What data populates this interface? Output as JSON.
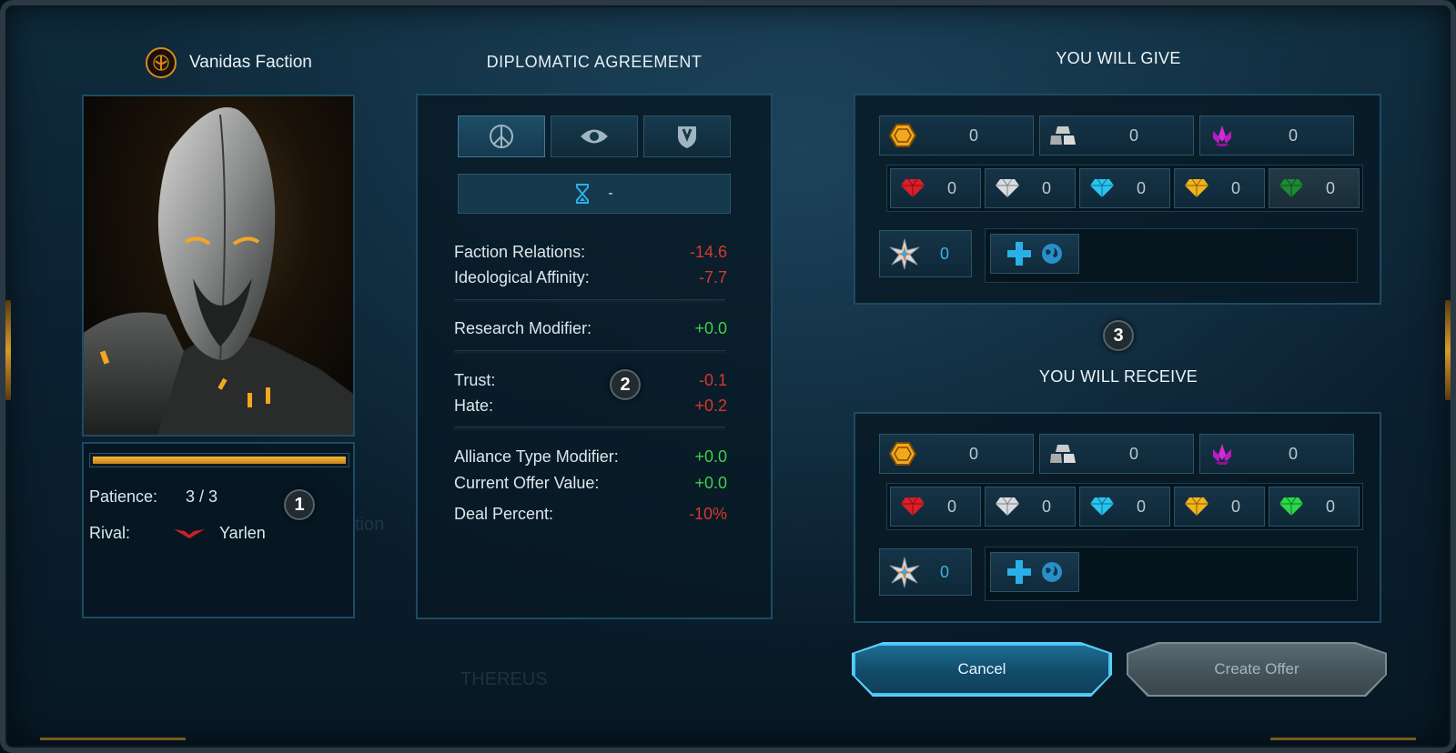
{
  "left": {
    "faction_name": "Vanidas Faction",
    "patience_label": "Patience:",
    "patience_value": "3 / 3",
    "patience_fill": 1.0,
    "rival_label": "Rival:",
    "rival_name": "Yarlen",
    "badge": "1"
  },
  "middle": {
    "title": "DIPLOMATIC AGREEMENT",
    "tabs": [
      {
        "icon": "peace-icon",
        "active": true
      },
      {
        "icon": "eye-icon",
        "active": false
      },
      {
        "icon": "shield-icon",
        "active": false
      }
    ],
    "duration_value": "-",
    "stats": {
      "faction_relations": {
        "label": "Faction Relations:",
        "value": "-14.6"
      },
      "ideological_affinity": {
        "label": "Ideological Affinity:",
        "value": "-7.7"
      },
      "research_modifier": {
        "label": "Research Modifier:",
        "value": "+0.0"
      },
      "trust": {
        "label": "Trust:",
        "value": "-0.1"
      },
      "hate": {
        "label": "Hate:",
        "value": "+0.2"
      },
      "alliance_type_modifier": {
        "label": "Alliance Type Modifier:",
        "value": "+0.0"
      },
      "current_offer_value": {
        "label": "Current Offer Value:",
        "value": "+0.0"
      },
      "deal_percent": {
        "label": "Deal Percent:",
        "value": "-10%"
      }
    },
    "badge": "2"
  },
  "give": {
    "title": "YOU WILL GIVE",
    "resources": {
      "credits": "0",
      "alloys": "0",
      "crystal": "0"
    },
    "gems": {
      "red": "0",
      "white": "0",
      "cyan": "0",
      "gold": "0",
      "green": "0"
    },
    "influence": "0"
  },
  "receive": {
    "title": "YOU WILL RECEIVE",
    "resources": {
      "credits": "0",
      "alloys": "0",
      "crystal": "0"
    },
    "gems": {
      "red": "0",
      "white": "0",
      "cyan": "0",
      "gold": "0",
      "green": "0"
    },
    "influence": "0"
  },
  "badge3": "3",
  "buttons": {
    "cancel": "Cancel",
    "create": "Create Offer"
  },
  "ghost_text": {
    "thereus": "THEREUS",
    "tion": "tion"
  },
  "colors": {
    "accent_orange": "#d98a1c",
    "negative": "#d8382e",
    "positive": "#3ed04a",
    "influence": "#39b4e4"
  }
}
